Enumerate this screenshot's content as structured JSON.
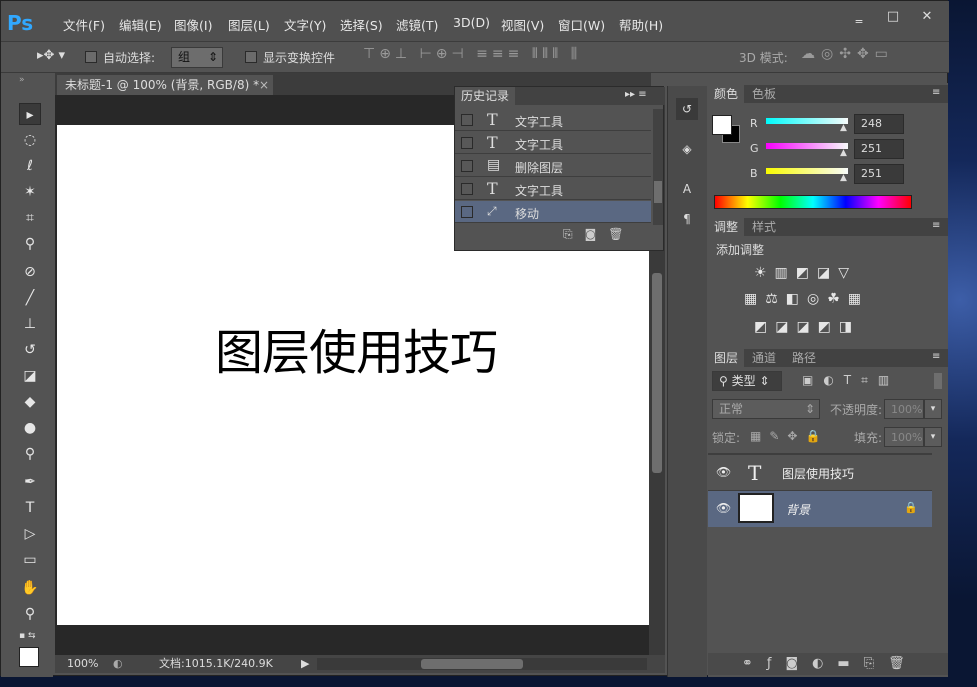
{
  "app": {
    "logo": "Ps"
  },
  "menu": [
    "文件(F)",
    "编辑(E)",
    "图像(I)",
    "图层(L)",
    "文字(Y)",
    "选择(S)",
    "滤镜(T)",
    "3D(D)",
    "视图(V)",
    "窗口(W)",
    "帮助(H)"
  ],
  "window_buttons": [
    "‗",
    "□",
    "✕"
  ],
  "options": {
    "auto_select_label": "自动选择:",
    "auto_select_value": "组",
    "transform_label": "显示变换控件",
    "mode_label": "3D 模式:"
  },
  "document": {
    "tab_title": "未标题-1 @ 100% (背景, RGB/8) *",
    "canvas_text": "图层使用技巧"
  },
  "status": {
    "zoom": "100%",
    "doc_info": "文档:1015.1K/240.9K"
  },
  "history": {
    "title": "历史记录",
    "items": [
      {
        "label": "文字工具",
        "icon": "T"
      },
      {
        "label": "文字工具",
        "icon": "T"
      },
      {
        "label": "删除图层",
        "icon": "▤"
      },
      {
        "label": "文字工具",
        "icon": "T"
      },
      {
        "label": "移动",
        "icon": "⤢"
      }
    ]
  },
  "color_panel": {
    "tabs": [
      "颜色",
      "色板"
    ],
    "channels": [
      {
        "name": "R",
        "value": "248"
      },
      {
        "name": "G",
        "value": "251"
      },
      {
        "name": "B",
        "value": "251"
      }
    ]
  },
  "adjust_panel": {
    "tabs": [
      "调整",
      "样式"
    ],
    "title": "添加调整"
  },
  "layers_panel": {
    "tabs": [
      "图层",
      "通道",
      "路径"
    ],
    "kind": "类型",
    "blend": "正常",
    "opacity_label": "不透明度:",
    "opacity_value": "100%",
    "lock_label": "锁定:",
    "fill_label": "填充:",
    "fill_value": "100%",
    "layers": [
      {
        "name": "图层使用技巧",
        "icon": "T"
      },
      {
        "name": "背景"
      }
    ]
  },
  "accent": "#31a8ff"
}
